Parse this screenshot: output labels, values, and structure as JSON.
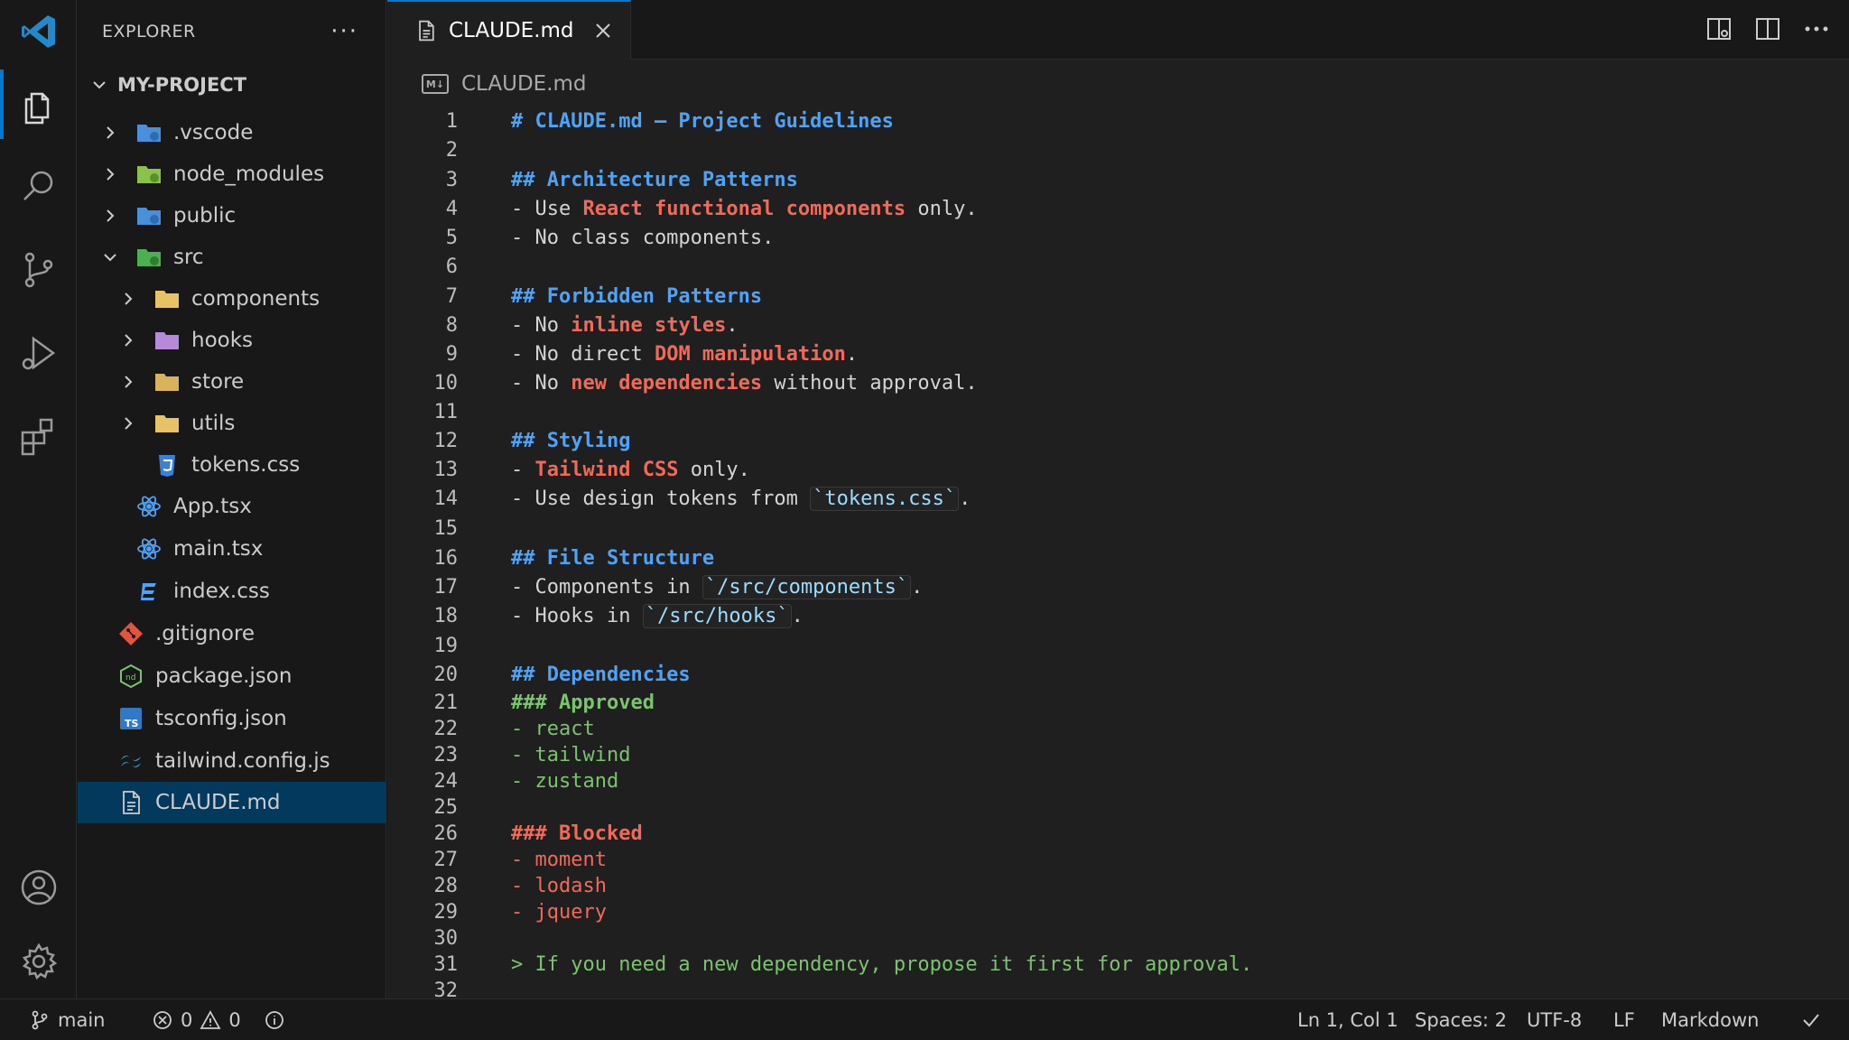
{
  "sidebar": {
    "title": "EXPLORER",
    "more": "···",
    "project": "MY-PROJECT",
    "items": [
      {
        "label": ".vscode"
      },
      {
        "label": "node_modules"
      },
      {
        "label": "public"
      },
      {
        "label": "src"
      },
      {
        "label": "components"
      },
      {
        "label": "hooks"
      },
      {
        "label": "store"
      },
      {
        "label": "utils"
      },
      {
        "label": "tokens.css"
      },
      {
        "label": "App.tsx"
      },
      {
        "label": "main.tsx"
      },
      {
        "label": "index.css"
      },
      {
        "label": ".gitignore"
      },
      {
        "label": "package.json"
      },
      {
        "label": "tsconfig.json"
      },
      {
        "label": "tailwind.config.js"
      },
      {
        "label": "CLAUDE.md"
      }
    ]
  },
  "tab": {
    "label": "CLAUDE.md"
  },
  "breadcrumb": {
    "badge": "M↓",
    "file": "CLAUDE.md"
  },
  "editor": {
    "line_numbers": [
      "1",
      "2",
      "3",
      "4",
      "5",
      "6",
      "7",
      "8",
      "9",
      "10",
      "11",
      "12",
      "13",
      "14",
      "15",
      "16",
      "17",
      "18",
      "19",
      "20",
      "21",
      "22",
      "23",
      "24",
      "25",
      "26",
      "27",
      "28",
      "29",
      "30",
      "31",
      "32"
    ],
    "l1": "# CLAUDE.md – Project Guidelines",
    "l3": "## Architecture Patterns",
    "l4a": "- Use ",
    "l4b": "React functional components",
    "l4c": " only.",
    "l5": "- No class components.",
    "l7": "## Forbidden Patterns",
    "l8a": "- No ",
    "l8b": "inline styles",
    "l8c": ".",
    "l9a": "- No direct ",
    "l9b": "DOM manipulation",
    "l9c": ".",
    "l10a": "- No ",
    "l10b": "new dependencies",
    "l10c": " without approval.",
    "l12": "## Styling",
    "l13a": "- ",
    "l13b": "Tailwind CSS",
    "l13c": " only.",
    "l14a": "- Use design tokens from ",
    "l14b": "`tokens.css`",
    "l14c": ".",
    "l16": "## File Structure",
    "l17a": "- Components in ",
    "l17b": "`/src/components`",
    "l17c": ".",
    "l18a": "- Hooks in ",
    "l18b": "`/src/hooks`",
    "l18c": ".",
    "l20": "## Dependencies",
    "l21": "### Approved",
    "l22": "- react",
    "l23": "- tailwind",
    "l24": "- zustand",
    "l26": "### Blocked",
    "l27": "- moment",
    "l28": "- lodash",
    "l29": "- jquery",
    "l31": "> If you need a new dependency, propose it first for approval."
  },
  "status": {
    "branch": "main",
    "errors": "0",
    "warnings": "0",
    "position": "Ln 1, Col 1",
    "spaces": "Spaces: 2",
    "encoding": "UTF-8",
    "eol": "LF",
    "language": "Markdown"
  }
}
